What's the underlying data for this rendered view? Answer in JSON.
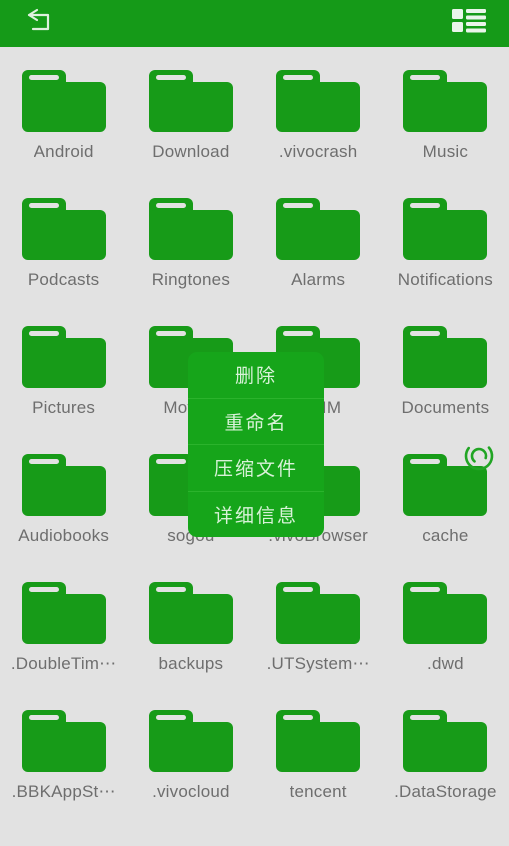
{
  "header": {
    "back_icon": "back-arrow-icon",
    "view_toggle_icon": "list-view-icon",
    "background_color": "#159a18"
  },
  "theme": {
    "accent_green": "#159a18",
    "folder_green": "#179b18",
    "menu_green": "#16a51a",
    "page_background": "#e2e2e2",
    "label_text": "#6e6e6e",
    "menu_text": "#d8f2d8"
  },
  "file_grid": {
    "columns": 4,
    "items": [
      {
        "label": "Android",
        "icon": "folder-icon"
      },
      {
        "label": "Download",
        "icon": "folder-icon"
      },
      {
        "label": ".vivocrash",
        "icon": "folder-icon"
      },
      {
        "label": "Music",
        "icon": "folder-icon"
      },
      {
        "label": "Podcasts",
        "icon": "folder-icon"
      },
      {
        "label": "Ringtones",
        "icon": "folder-icon"
      },
      {
        "label": "Alarms",
        "icon": "folder-icon"
      },
      {
        "label": "Notifications",
        "icon": "folder-icon"
      },
      {
        "label": "Pictures",
        "icon": "folder-icon"
      },
      {
        "label": "Movies",
        "icon": "folder-icon"
      },
      {
        "label": "QQIM",
        "icon": "folder-icon"
      },
      {
        "label": "Documents",
        "icon": "folder-icon"
      },
      {
        "label": "Audiobooks",
        "icon": "folder-icon"
      },
      {
        "label": "sogou",
        "icon": "folder-icon"
      },
      {
        "label": ".vivoBrowser",
        "icon": "folder-icon"
      },
      {
        "label": "cache",
        "icon": "folder-icon"
      },
      {
        "label": ".DoubleTim⋯",
        "icon": "folder-icon"
      },
      {
        "label": "backups",
        "icon": "folder-icon"
      },
      {
        "label": ".UTSystem⋯",
        "icon": "folder-icon"
      },
      {
        "label": ".dwd",
        "icon": "folder-icon"
      },
      {
        "label": ".BBKAppSt⋯",
        "icon": "folder-icon"
      },
      {
        "label": ".vivocloud",
        "icon": "folder-icon"
      },
      {
        "label": "tencent",
        "icon": "folder-icon"
      },
      {
        "label": ".DataStorage",
        "icon": "folder-icon"
      }
    ]
  },
  "context_menu": {
    "items": [
      {
        "label": "删除"
      },
      {
        "label": "重命名"
      },
      {
        "label": "压缩文件"
      },
      {
        "label": "详细信息"
      }
    ]
  },
  "spinner": {
    "icon": "refresh-spinner-icon"
  }
}
